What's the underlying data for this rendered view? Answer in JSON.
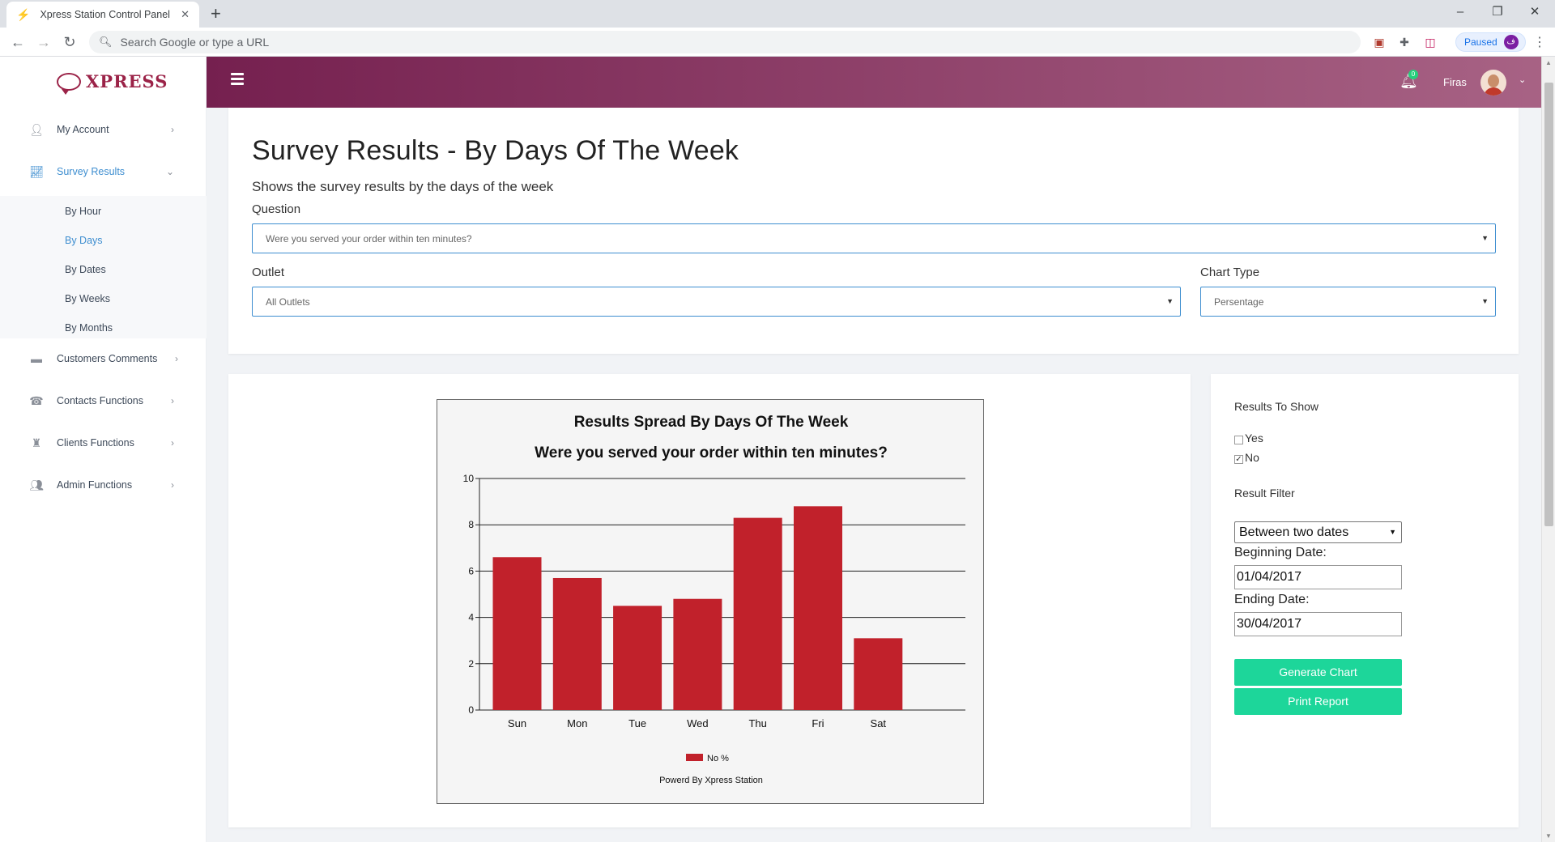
{
  "browser": {
    "tab_title": "Xpress Station Control Panel",
    "address_placeholder": "Search Google or type a URL",
    "profile_status": "Paused",
    "profile_initial": "ف"
  },
  "sidebar": {
    "brand": "XPRESS",
    "items": [
      {
        "label": "My Account"
      },
      {
        "label": "Survey Results"
      },
      {
        "label": "Customers Comments"
      },
      {
        "label": "Contacts Functions"
      },
      {
        "label": "Clients Functions"
      },
      {
        "label": "Admin Functions"
      }
    ],
    "sub_items": [
      {
        "label": "By Hour"
      },
      {
        "label": "By Days"
      },
      {
        "label": "By Dates"
      },
      {
        "label": "By Weeks"
      },
      {
        "label": "By Months"
      }
    ]
  },
  "header": {
    "notification_count": "0",
    "user_name": "Firas"
  },
  "page": {
    "title": "Survey Results - By Days Of The Week",
    "subtitle": "Shows the survey results by the days of the week",
    "question_label": "Question",
    "question_value": "Were you served your order within ten minutes?",
    "outlet_label": "Outlet",
    "outlet_value": "All Outlets",
    "chart_type_label": "Chart Type",
    "chart_type_value": "Persentage"
  },
  "options": {
    "results_to_show_label": "Results To Show",
    "yes_label": "Yes",
    "no_label": "No",
    "result_filter_label": "Result Filter",
    "filter_value": "Between two dates",
    "beginning_label": "Beginning Date:",
    "beginning_value": "01/04/2017",
    "ending_label": "Ending Date:",
    "ending_value": "30/04/2017",
    "generate_label": "Generate Chart",
    "print_label": "Print Report"
  },
  "chart_data": {
    "type": "bar",
    "title": "Results Spread By Days Of The Week",
    "subtitle": "Were you served your order within ten minutes?",
    "categories": [
      "Sun",
      "Mon",
      "Tue",
      "Wed",
      "Thu",
      "Fri",
      "Sat"
    ],
    "series": [
      {
        "name": "No %",
        "values": [
          6.6,
          5.7,
          4.5,
          4.8,
          8.3,
          8.8,
          3.1
        ],
        "color": "#c1212b"
      }
    ],
    "ylim": [
      0,
      10
    ],
    "yticks": [
      0,
      2,
      4,
      6,
      8,
      10
    ],
    "grid": true,
    "legend": "bottom",
    "footer": "Powerd By Xpress Station"
  },
  "colors": {
    "accent": "#3e8ed0",
    "header_start": "#75204f",
    "header_end": "#a86385",
    "button": "#1dd69a"
  }
}
